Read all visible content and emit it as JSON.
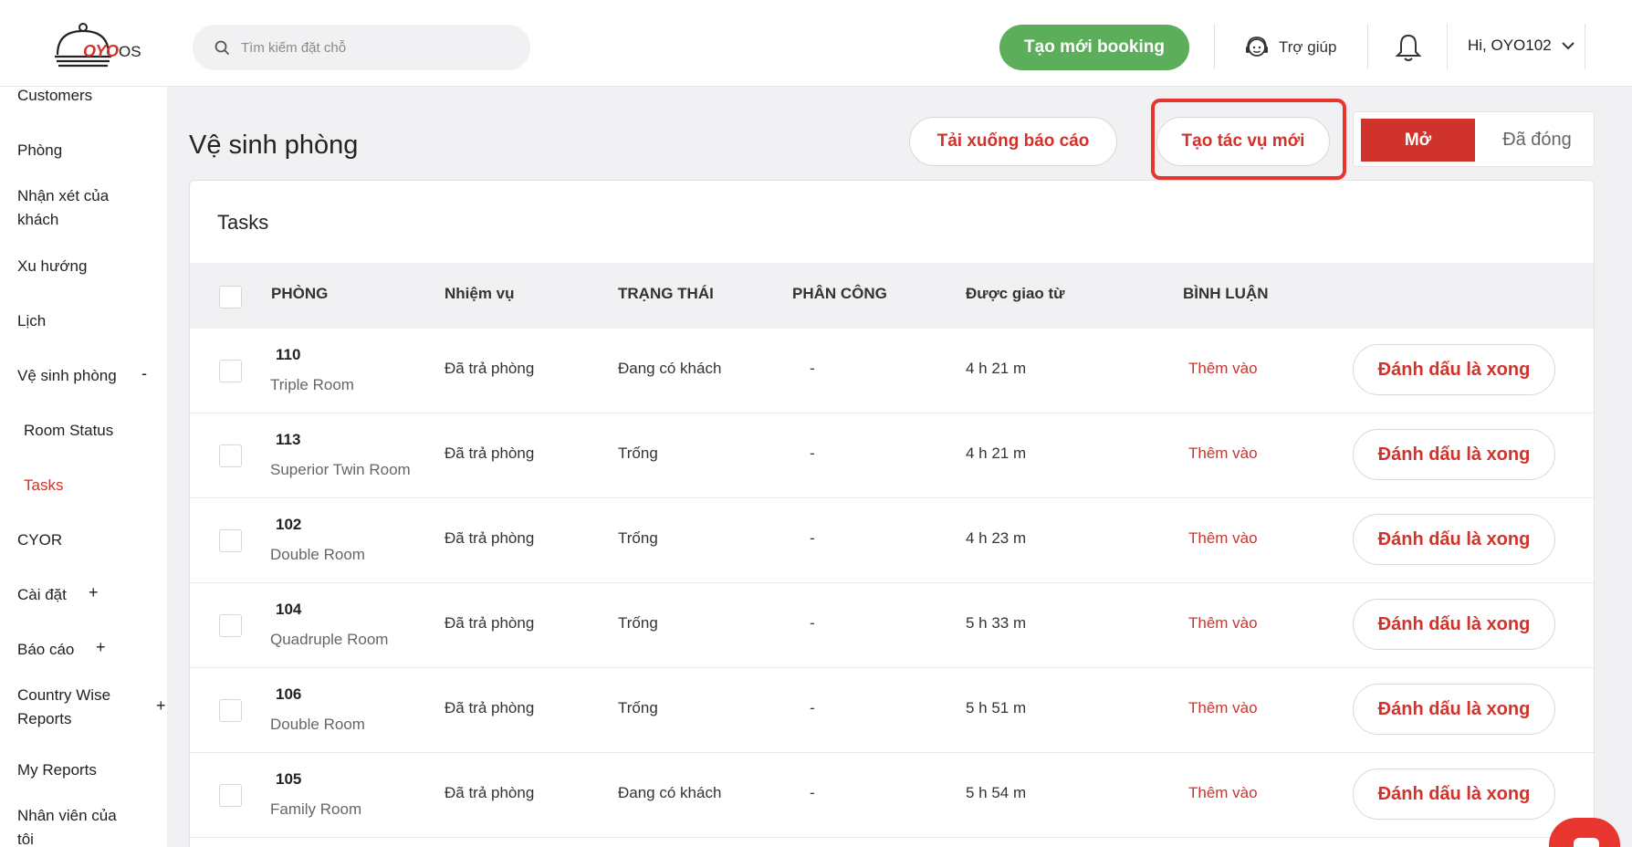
{
  "header": {
    "logo_brand": "OYO",
    "logo_suffix": "OS",
    "search_placeholder": "Tìm kiếm đặt chỗ",
    "new_booking": "Tạo mới booking",
    "help": "Trợ giúp",
    "user_greeting": "Hi, OYO102"
  },
  "sidebar": {
    "items": [
      {
        "label": "Customers"
      },
      {
        "label": "Phòng"
      },
      {
        "label": "Nhận xét của\nkhách"
      },
      {
        "label": "Xu hướng"
      },
      {
        "label": "Lịch"
      },
      {
        "label": "Vệ sinh phòng",
        "sign": "-"
      },
      {
        "label": "Room Status"
      },
      {
        "label": "Tasks"
      },
      {
        "label": "CYOR"
      },
      {
        "label": "Cài đặt",
        "sign": "+"
      },
      {
        "label": "Báo cáo",
        "sign": "+"
      },
      {
        "label": "Country Wise\nReports",
        "sign": "+"
      },
      {
        "label": "My Reports"
      },
      {
        "label": "Nhân viên của\ntôi"
      }
    ]
  },
  "main": {
    "title": "Vệ sinh phòng",
    "download_report": "Tải xuống báo cáo",
    "new_task": "Tạo tác vụ mới",
    "toggle_open": "Mở",
    "toggle_closed": "Đã đóng",
    "card_title": "Tasks"
  },
  "table": {
    "columns": [
      "PHÒNG",
      "Nhiệm vụ",
      "TRẠNG THÁI",
      "PHÂN CÔNG",
      "Được giao từ",
      "BÌNH LUẬN"
    ],
    "rows": [
      {
        "room": "110",
        "type": "Triple Room",
        "task": "Đã trả phòng",
        "status": "Đang có khách",
        "assign": "-",
        "since": "4 h 21 m",
        "comment": "Thêm vào",
        "action": "Đánh dấu là xong"
      },
      {
        "room": "113",
        "type": "Superior Twin Room",
        "task": "Đã trả phòng",
        "status": "Trống",
        "assign": "-",
        "since": "4 h 21 m",
        "comment": "Thêm vào",
        "action": "Đánh dấu là xong"
      },
      {
        "room": "102",
        "type": "Double Room",
        "task": "Đã trả phòng",
        "status": "Trống",
        "assign": "-",
        "since": "4 h 23 m",
        "comment": "Thêm vào",
        "action": "Đánh dấu là xong"
      },
      {
        "room": "104",
        "type": "Quadruple Room",
        "task": "Đã trả phòng",
        "status": "Trống",
        "assign": "-",
        "since": "5 h 33 m",
        "comment": "Thêm vào",
        "action": "Đánh dấu là xong"
      },
      {
        "room": "106",
        "type": "Double Room",
        "task": "Đã trả phòng",
        "status": "Trống",
        "assign": "-",
        "since": "5 h 51 m",
        "comment": "Thêm vào",
        "action": "Đánh dấu là xong"
      },
      {
        "room": "105",
        "type": "Family Room",
        "task": "Đã trả phòng",
        "status": "Đang có khách",
        "assign": "-",
        "since": "5 h 54 m",
        "comment": "Thêm vào",
        "action": "Đánh dấu là xong"
      }
    ]
  },
  "colors": {
    "brand_red": "#d0332b",
    "booking_green": "#5cae5b",
    "highlight_red": "#e8362e"
  }
}
